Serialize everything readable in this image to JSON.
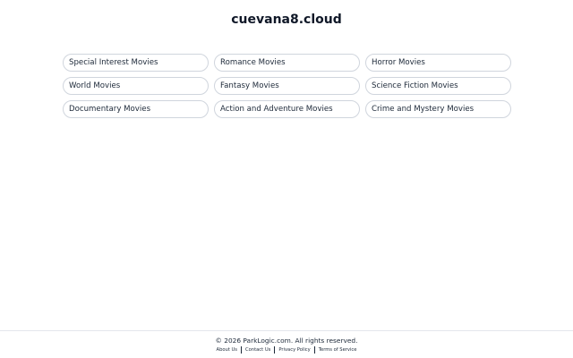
{
  "header": {
    "title": "cuevana8.cloud"
  },
  "categories": [
    "Special Interest Movies",
    "Romance Movies",
    "Horror Movies",
    "World Movies",
    "Fantasy Movies",
    "Science Fiction Movies",
    "Documentary Movies",
    "Action and Adventure Movies",
    "Crime and Mystery Movies"
  ],
  "footer": {
    "copyright": "© 2026 ParkLogic.com. All rights reserved.",
    "links": [
      "About Us",
      "Contact Us",
      "Privacy Policy",
      "Terms of Service"
    ]
  }
}
